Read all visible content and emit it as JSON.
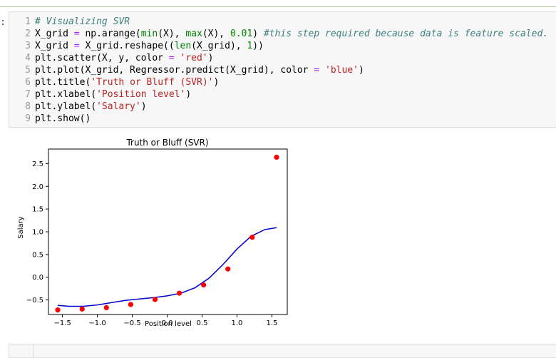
{
  "notebook": {
    "prompt_fragment": ":",
    "code_cell": {
      "lines": [
        {
          "no": "1",
          "tokens": [
            {
              "t": "# Visualizing SVR",
              "c": "c-com"
            }
          ]
        },
        {
          "no": "2",
          "tokens": [
            {
              "t": "X_grid ",
              "c": "c-txt"
            },
            {
              "t": "=",
              "c": "c-op"
            },
            {
              "t": " np.arange(",
              "c": "c-txt"
            },
            {
              "t": "min",
              "c": "c-bi"
            },
            {
              "t": "(X), ",
              "c": "c-txt"
            },
            {
              "t": "max",
              "c": "c-bi"
            },
            {
              "t": "(X), ",
              "c": "c-txt"
            },
            {
              "t": "0.01",
              "c": "c-num"
            },
            {
              "t": ") ",
              "c": "c-txt"
            },
            {
              "t": "#this step required because data is feature scaled.",
              "c": "c-com"
            }
          ]
        },
        {
          "no": "3",
          "tokens": [
            {
              "t": "X_grid ",
              "c": "c-txt"
            },
            {
              "t": "=",
              "c": "c-op"
            },
            {
              "t": " X_grid.reshape((",
              "c": "c-txt"
            },
            {
              "t": "len",
              "c": "c-bi"
            },
            {
              "t": "(X_grid), ",
              "c": "c-txt"
            },
            {
              "t": "1",
              "c": "c-num"
            },
            {
              "t": "))",
              "c": "c-txt"
            }
          ]
        },
        {
          "no": "4",
          "tokens": [
            {
              "t": "plt.scatter(X, y, color ",
              "c": "c-txt"
            },
            {
              "t": "=",
              "c": "c-op"
            },
            {
              "t": " ",
              "c": "c-txt"
            },
            {
              "t": "'red'",
              "c": "c-str"
            },
            {
              "t": ")",
              "c": "c-txt"
            }
          ]
        },
        {
          "no": "5",
          "tokens": [
            {
              "t": "plt.plot(X_grid, Regressor.predict(X_grid), color ",
              "c": "c-txt"
            },
            {
              "t": "=",
              "c": "c-op"
            },
            {
              "t": " ",
              "c": "c-txt"
            },
            {
              "t": "'blue'",
              "c": "c-str"
            },
            {
              "t": ")",
              "c": "c-txt"
            }
          ]
        },
        {
          "no": "6",
          "tokens": [
            {
              "t": "plt.title(",
              "c": "c-txt"
            },
            {
              "t": "'Truth or Bluff (SVR)'",
              "c": "c-str"
            },
            {
              "t": ")",
              "c": "c-txt"
            }
          ]
        },
        {
          "no": "7",
          "tokens": [
            {
              "t": "plt.xlabel(",
              "c": "c-txt"
            },
            {
              "t": "'Position level'",
              "c": "c-str"
            },
            {
              "t": ")",
              "c": "c-txt"
            }
          ]
        },
        {
          "no": "8",
          "tokens": [
            {
              "t": "plt.ylabel(",
              "c": "c-txt"
            },
            {
              "t": "'Salary'",
              "c": "c-str"
            },
            {
              "t": ")",
              "c": "c-txt"
            }
          ]
        },
        {
          "no": "9",
          "tokens": [
            {
              "t": "plt.show()",
              "c": "c-txt"
            }
          ]
        }
      ]
    }
  },
  "chart_data": {
    "type": "scatter",
    "title": "Truth or Bluff (SVR)",
    "xlabel": "Position level",
    "ylabel": "Salary",
    "xlim": [
      -1.7,
      1.72
    ],
    "ylim": [
      -0.82,
      2.82
    ],
    "xticks": [
      -1.5,
      -1.0,
      -0.5,
      0.0,
      0.5,
      1.0,
      1.5
    ],
    "xtick_labels": [
      "−1.5",
      "−1.0",
      "−0.5",
      "0.0",
      "0.5",
      "1.0",
      "1.5"
    ],
    "yticks": [
      -0.5,
      0.0,
      0.5,
      1.0,
      1.5,
      2.0,
      2.5
    ],
    "ytick_labels": [
      "−0.5",
      "0.0",
      "0.5",
      "1.0",
      "1.5",
      "2.0",
      "2.5"
    ],
    "grid": false,
    "colors": {
      "points": "#ff0000",
      "line": "#0000cc"
    },
    "series": [
      {
        "kind": "scatter",
        "x": [
          -1.567,
          -1.218,
          -0.87,
          -0.522,
          -0.174,
          0.174,
          0.522,
          0.87,
          1.218,
          1.567
        ],
        "y": [
          -0.72,
          -0.7,
          -0.67,
          -0.6,
          -0.49,
          -0.35,
          -0.17,
          0.18,
          0.88,
          2.64
        ]
      },
      {
        "kind": "line",
        "x": [
          -1.567,
          -1.4,
          -1.2,
          -1.0,
          -0.8,
          -0.6,
          -0.4,
          -0.2,
          0.0,
          0.2,
          0.4,
          0.6,
          0.8,
          1.0,
          1.2,
          1.4,
          1.567
        ],
        "y": [
          -0.62,
          -0.64,
          -0.64,
          -0.61,
          -0.56,
          -0.51,
          -0.48,
          -0.45,
          -0.41,
          -0.35,
          -0.23,
          -0.02,
          0.28,
          0.62,
          0.9,
          1.05,
          1.09
        ]
      }
    ]
  }
}
